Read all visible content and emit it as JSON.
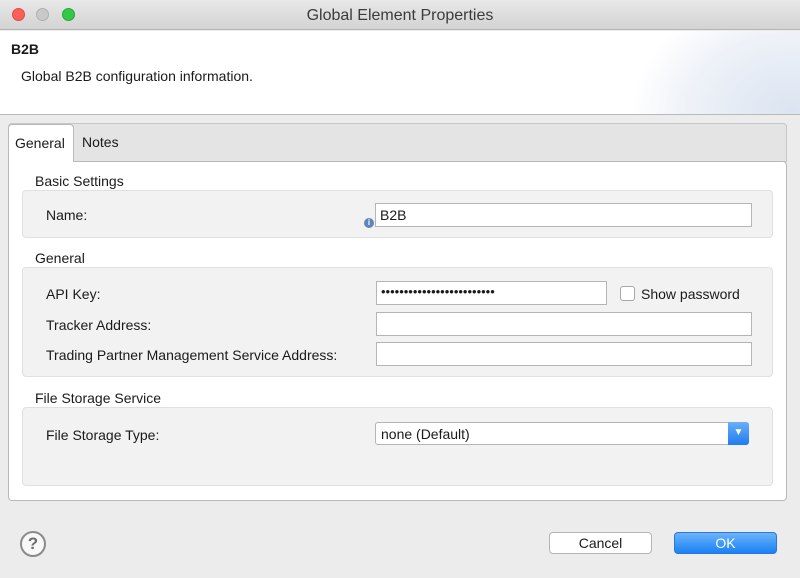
{
  "window": {
    "title": "Global Element Properties"
  },
  "header": {
    "title": "B2B",
    "description": "Global B2B configuration information."
  },
  "tabs": [
    {
      "label": "General",
      "selected": true
    },
    {
      "label": "Notes",
      "selected": false
    }
  ],
  "sections": {
    "basic": {
      "label": "Basic Settings",
      "name_label": "Name:",
      "name_value": "B2B",
      "info_icon": "info-icon"
    },
    "general": {
      "label": "General",
      "api_key_label": "API Key:",
      "api_key_value": "•••••••••••••••••••••••••",
      "show_password_label": "Show password",
      "show_password_checked": false,
      "tracker_label": "Tracker Address:",
      "tracker_value": "",
      "tpm_label": "Trading Partner Management Service Address:",
      "tpm_value": ""
    },
    "storage": {
      "label": "File Storage Service",
      "type_label": "File Storage Type:",
      "type_value": "none (Default)"
    }
  },
  "footer": {
    "help_glyph": "?",
    "cancel_label": "Cancel",
    "ok_label": "OK"
  },
  "colors": {
    "accent": "#1a81f5",
    "close": "#fc605c",
    "maximize": "#34c84a"
  }
}
